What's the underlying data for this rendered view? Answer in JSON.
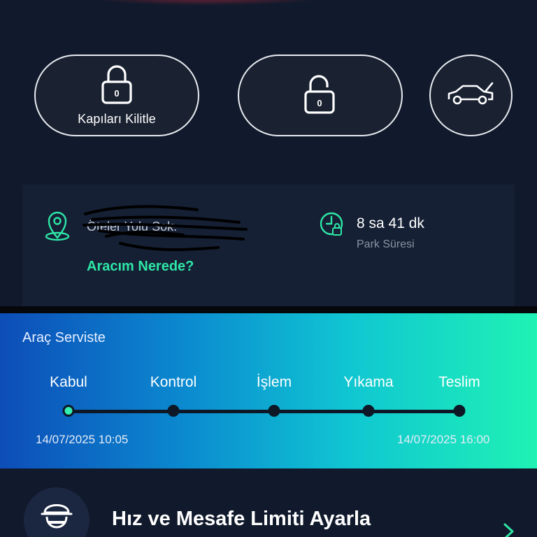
{
  "controls": {
    "lock_label": "Kapıları Kilitle",
    "lock_badge": "0",
    "unlock_badge": "0"
  },
  "location": {
    "address": "Öteler Yolu Sok.",
    "link": "Aracım Nerede?",
    "park_time": "8 sa 41 dk",
    "park_label": "Park Süresi"
  },
  "service": {
    "title": "Araç Serviste",
    "steps": [
      "Kabul",
      "Kontrol",
      "İşlem",
      "Yıkama",
      "Teslim"
    ],
    "current_step_index": 0,
    "start_date": "14/07/2025 10:05",
    "end_date": "14/07/2025 16:00"
  },
  "limit": {
    "title": "Hız ve Mesafe Limiti Ayarla"
  },
  "colors": {
    "background": "#111a2c",
    "accent": "#2ee6a6",
    "gradient_start": "#0d4db8",
    "gradient_end": "#1ff2b4"
  },
  "icons": {
    "lock": "lock-icon",
    "unlock": "unlock-icon",
    "trunk": "car-trunk-icon",
    "pin": "location-pin-icon",
    "clock": "clock-lock-icon",
    "driver": "driver-icon",
    "chevron": "chevron-right-icon"
  }
}
